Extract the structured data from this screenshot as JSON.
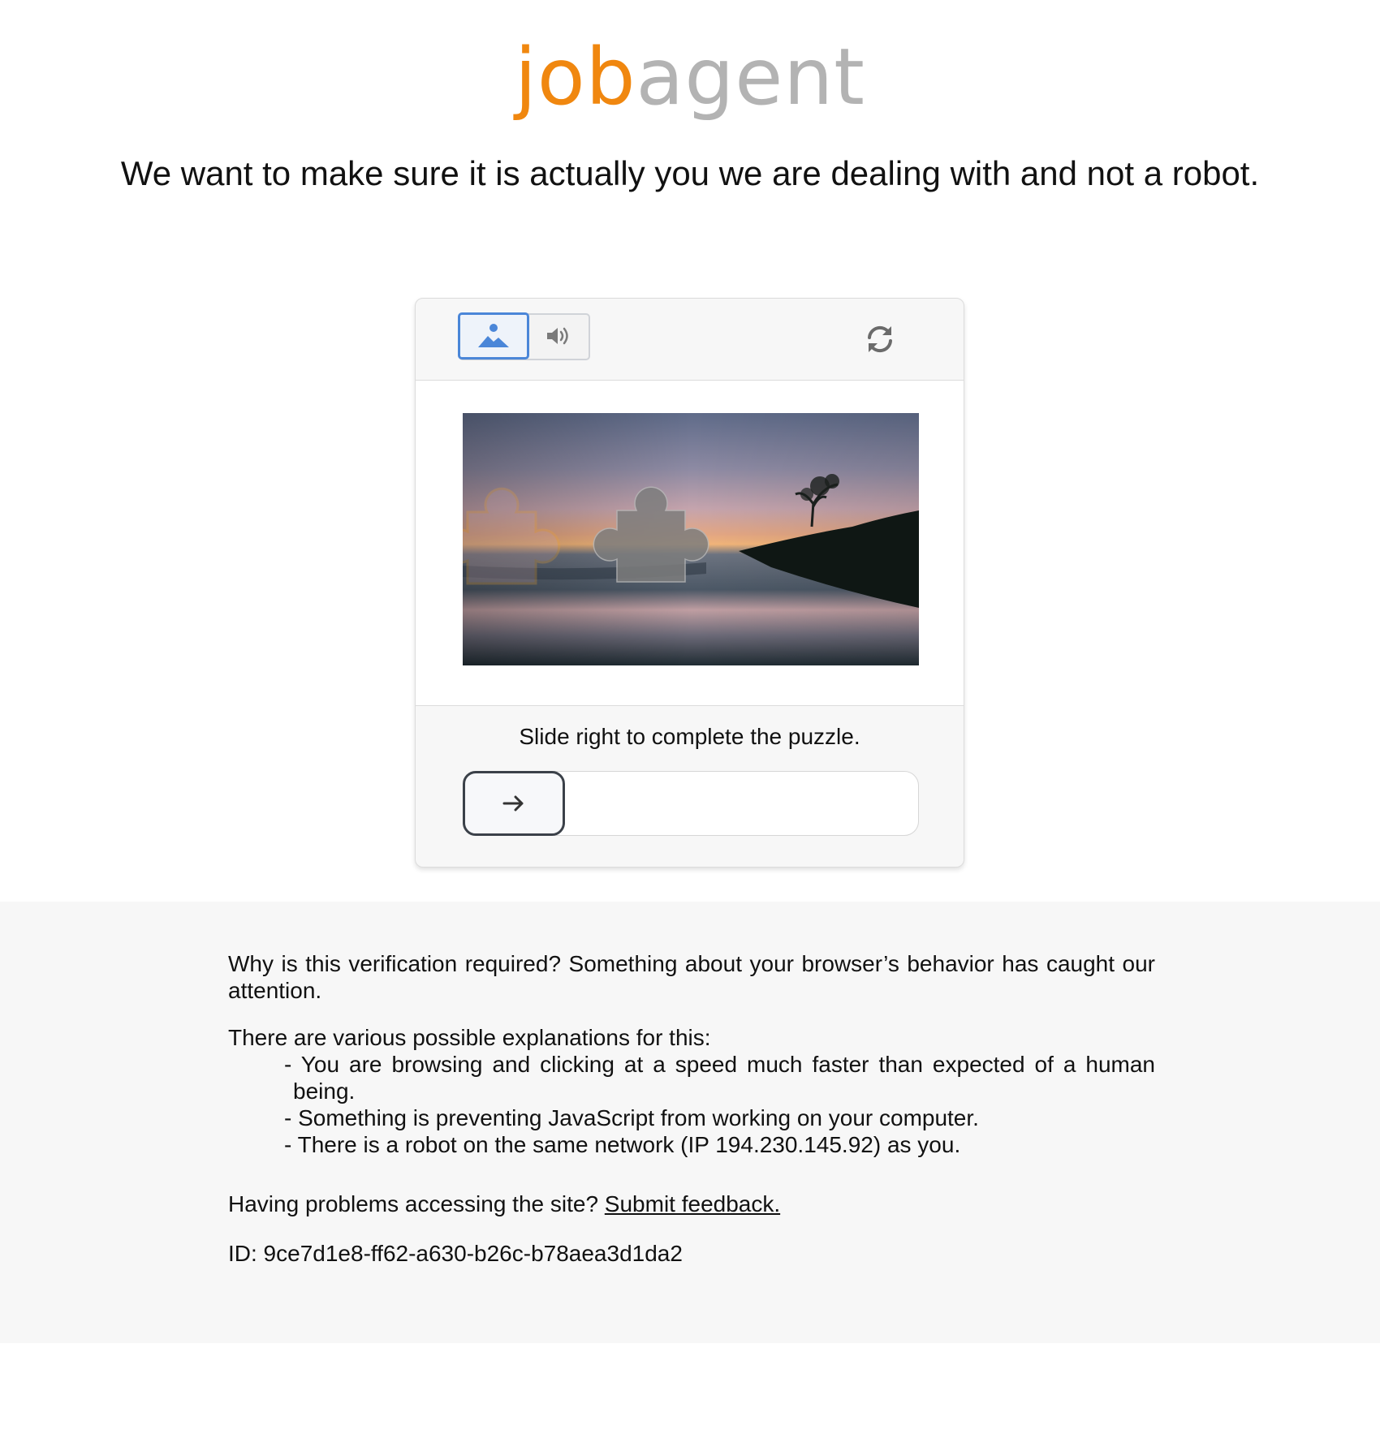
{
  "logo": {
    "part1": "job",
    "part2": "agent"
  },
  "headline": "We want to make sure it is actually you we are dealing with and not a robot.",
  "captcha": {
    "modes": [
      {
        "icon": "image-icon",
        "selected": true
      },
      {
        "icon": "speaker-icon",
        "selected": false
      }
    ],
    "refresh_icon": "refresh-icon",
    "instruction": "Slide right to complete the puzzle.",
    "slider_icon": "arrow-right-icon",
    "slider_progress": 0,
    "accent_color": "#4a86d8"
  },
  "info": {
    "why": "Why is this verification required? Something about your browser’s behavior has caught our attention.",
    "explanations_intro": "There are various possible explanations for this:",
    "reasons": [
      "- You are browsing and clicking at a speed much faster than expected of a human being.",
      "- Something is preventing JavaScript from working on your computer.",
      "- There is a robot on the same network (IP 194.230.145.92) as you."
    ],
    "problems_text": "Having problems accessing the site?",
    "feedback_link": "Submit feedback.",
    "id_text": "ID: 9ce7d1e8-ff62-a630-b26c-b78aea3d1da2"
  },
  "colors": {
    "logo_orange": "#f0870f",
    "logo_gray": "#b3b3b3"
  }
}
